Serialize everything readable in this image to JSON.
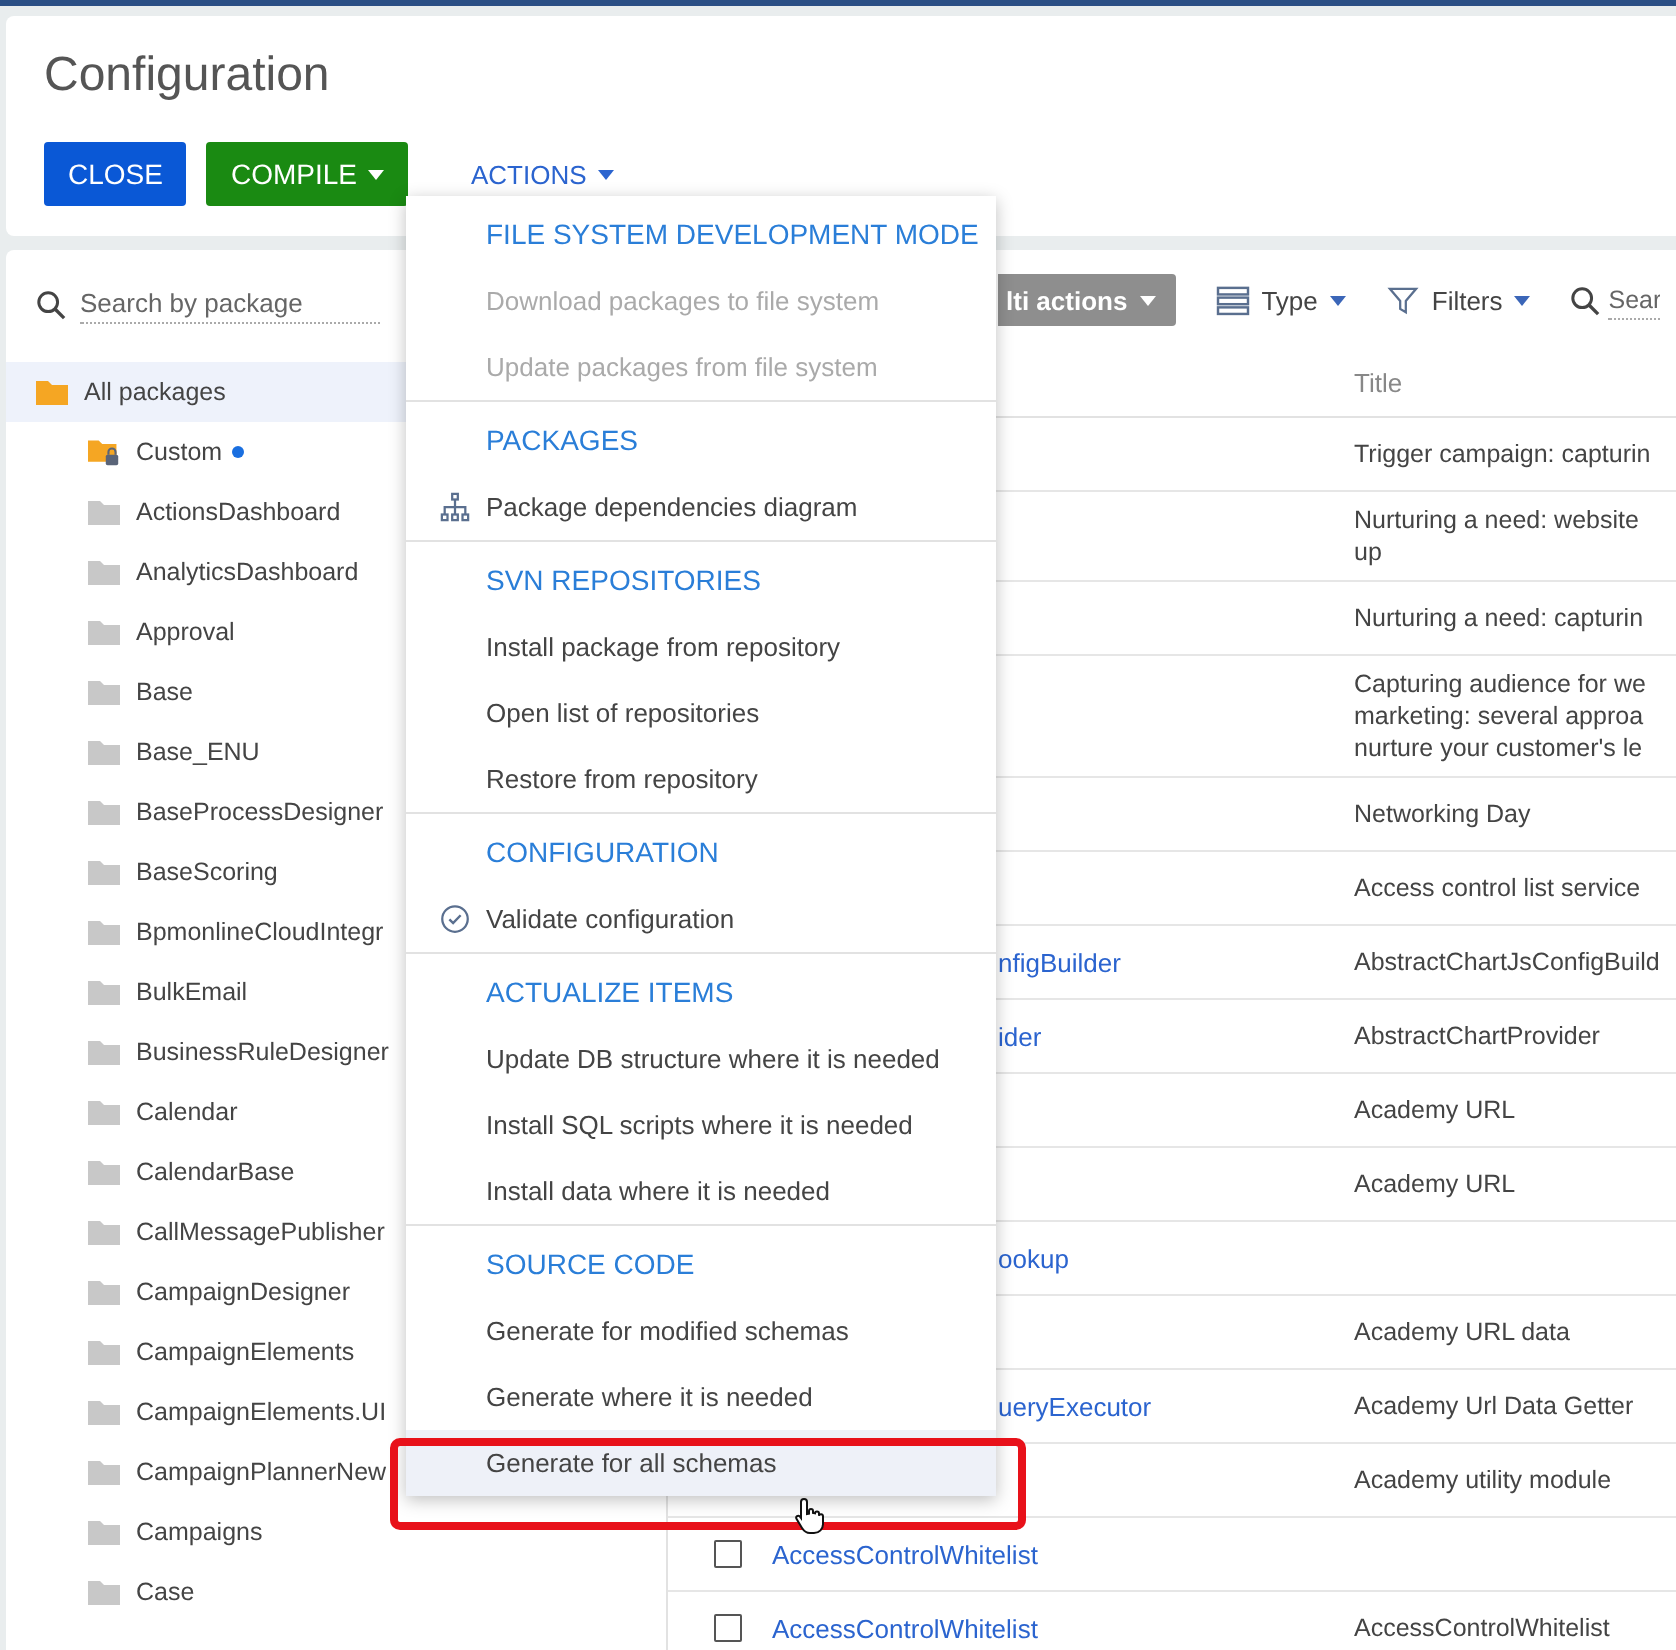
{
  "window": {
    "title": "Configuration"
  },
  "header_buttons": [
    {
      "label": "CLOSE",
      "kind": "primary",
      "caret": false
    },
    {
      "label": "COMPILE",
      "kind": "success",
      "caret": true
    },
    {
      "label": "ACTIONS",
      "kind": "link",
      "caret": true
    }
  ],
  "package_search": {
    "placeholder": "Search by package"
  },
  "package_tree": {
    "label": "All packages",
    "selected": true,
    "children": [
      {
        "label": "Custom",
        "kind": "custom",
        "selected": false,
        "modified": true
      },
      {
        "label": "ActionsDashboard",
        "kind": "package",
        "selected": false,
        "modified": false
      },
      {
        "label": "AnalyticsDashboard",
        "kind": "package",
        "selected": false,
        "modified": false
      },
      {
        "label": "Approval",
        "kind": "package",
        "selected": false,
        "modified": false
      },
      {
        "label": "Base",
        "kind": "package",
        "selected": false,
        "modified": false
      },
      {
        "label": "Base_ENU",
        "kind": "package",
        "selected": false,
        "modified": false
      },
      {
        "label": "BaseProcessDesigner",
        "kind": "package",
        "selected": false,
        "modified": false
      },
      {
        "label": "BaseScoring",
        "kind": "package",
        "selected": false,
        "modified": false
      },
      {
        "label": "BpmonlineCloudIntegr",
        "kind": "package",
        "selected": false,
        "modified": false
      },
      {
        "label": "BulkEmail",
        "kind": "package",
        "selected": false,
        "modified": false
      },
      {
        "label": "BusinessRuleDesigner",
        "kind": "package",
        "selected": false,
        "modified": false
      },
      {
        "label": "Calendar",
        "kind": "package",
        "selected": false,
        "modified": false
      },
      {
        "label": "CalendarBase",
        "kind": "package",
        "selected": false,
        "modified": false
      },
      {
        "label": "CallMessagePublisher",
        "kind": "package",
        "selected": false,
        "modified": false
      },
      {
        "label": "CampaignDesigner",
        "kind": "package",
        "selected": false,
        "modified": false
      },
      {
        "label": "CampaignElements",
        "kind": "package",
        "selected": false,
        "modified": false
      },
      {
        "label": "CampaignElements.UI",
        "kind": "package",
        "selected": false,
        "modified": false
      },
      {
        "label": "CampaignPlannerNew",
        "kind": "package",
        "selected": false,
        "modified": false
      },
      {
        "label": "Campaigns",
        "kind": "package",
        "selected": false,
        "modified": false
      },
      {
        "label": "Case",
        "kind": "package",
        "selected": false,
        "modified": false
      }
    ]
  },
  "toolbar": {
    "multi_actions": "lti actions",
    "type_button": "Type",
    "filters_button": "Filters",
    "search": {
      "placeholder": "Sear"
    }
  },
  "table": {
    "columns": [
      "Title"
    ],
    "rows": [
      {
        "title_lines": [
          "Trigger campaign: capturin"
        ]
      },
      {
        "title_lines": [
          "Nurturing a need: website",
          "up"
        ]
      },
      {
        "title_lines": [
          "Nurturing a need: capturin"
        ]
      },
      {
        "title_lines": [
          "Capturing audience for we",
          "marketing: several approa",
          "nurture your customer's le"
        ]
      },
      {
        "title_lines": [
          "Networking Day"
        ]
      },
      {
        "title_lines": [
          "Access control list service"
        ]
      },
      {
        "name": "nfigBuilder",
        "title_lines": [
          "AbstractChartJsConfigBuild"
        ]
      },
      {
        "name": "ider",
        "title_lines": [
          "AbstractChartProvider"
        ]
      },
      {
        "title_lines": [
          "Academy URL"
        ]
      },
      {
        "title_lines": [
          "Academy URL"
        ]
      },
      {
        "name": "ookup"
      },
      {
        "title_lines": [
          "Academy URL data"
        ]
      },
      {
        "name": "ueryExecutor",
        "title_lines": [
          "Academy Url Data Getter"
        ]
      },
      {
        "title_lines": [
          "Academy utility module"
        ]
      },
      {
        "checkbox": {
          "checked": false
        },
        "name": "AccessControlWhitelist"
      },
      {
        "checkbox": {
          "checked": false
        },
        "name": "AccessControlWhitelist",
        "title_lines": [
          "AccessControlWhitelist"
        ]
      }
    ]
  },
  "actions_menu": {
    "sections": [
      {
        "title": "FILE SYSTEM DEVELOPMENT MODE",
        "items": [
          {
            "label": "Download packages to file system",
            "kind": "plain",
            "disabled": true,
            "hovered": false
          },
          {
            "label": "Update packages from file system",
            "kind": "plain",
            "disabled": true,
            "hovered": false
          }
        ]
      },
      {
        "title": "PACKAGES",
        "items": [
          {
            "label": "Package dependencies diagram",
            "kind": "diagram",
            "disabled": false,
            "hovered": false
          }
        ]
      },
      {
        "title": "SVN REPOSITORIES",
        "items": [
          {
            "label": "Install package from repository",
            "kind": "plain",
            "disabled": false,
            "hovered": false
          },
          {
            "label": "Open list of repositories",
            "kind": "plain",
            "disabled": false,
            "hovered": false
          },
          {
            "label": "Restore from repository",
            "kind": "plain",
            "disabled": false,
            "hovered": false
          }
        ]
      },
      {
        "title": "CONFIGURATION",
        "items": [
          {
            "label": "Validate configuration",
            "kind": "validate",
            "disabled": false,
            "hovered": false
          }
        ]
      },
      {
        "title": "ACTUALIZE ITEMS",
        "items": [
          {
            "label": "Update DB structure where it is needed",
            "kind": "plain",
            "disabled": false,
            "hovered": false
          },
          {
            "label": "Install SQL scripts where it is needed",
            "kind": "plain",
            "disabled": false,
            "hovered": false
          },
          {
            "label": "Install data where it is needed",
            "kind": "plain",
            "disabled": false,
            "hovered": false
          }
        ]
      },
      {
        "title": "SOURCE CODE",
        "items": [
          {
            "label": "Generate for modified schemas",
            "kind": "plain",
            "disabled": false,
            "hovered": false
          },
          {
            "label": "Generate where it is needed",
            "kind": "plain",
            "disabled": false,
            "hovered": false
          },
          {
            "label": "Generate for all schemas",
            "kind": "plain",
            "disabled": false,
            "hovered": true
          }
        ]
      }
    ]
  }
}
